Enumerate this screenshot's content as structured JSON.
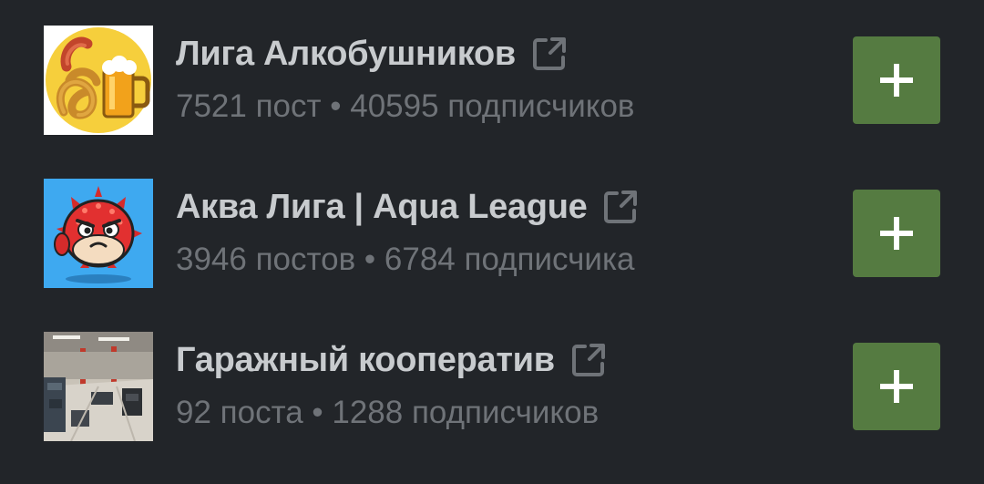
{
  "communities": [
    {
      "name": "Лига Алкобушников",
      "stats": "7521 пост • 40595 подписчиков",
      "avatar_icon": "sausage-pretzel-beer-icon"
    },
    {
      "name": "Аква Лига | Aqua League",
      "stats": "3946 постов • 6784 подписчика",
      "avatar_icon": "pufferfish-icon"
    },
    {
      "name": "Гаражный кооператив",
      "stats": "92 поста • 1288 подписчиков",
      "avatar_icon": "garage-photo-icon"
    }
  ],
  "colors": {
    "background": "#222529",
    "title": "#c8cbce",
    "stats": "#6f7378",
    "add_button": "#557b41"
  }
}
